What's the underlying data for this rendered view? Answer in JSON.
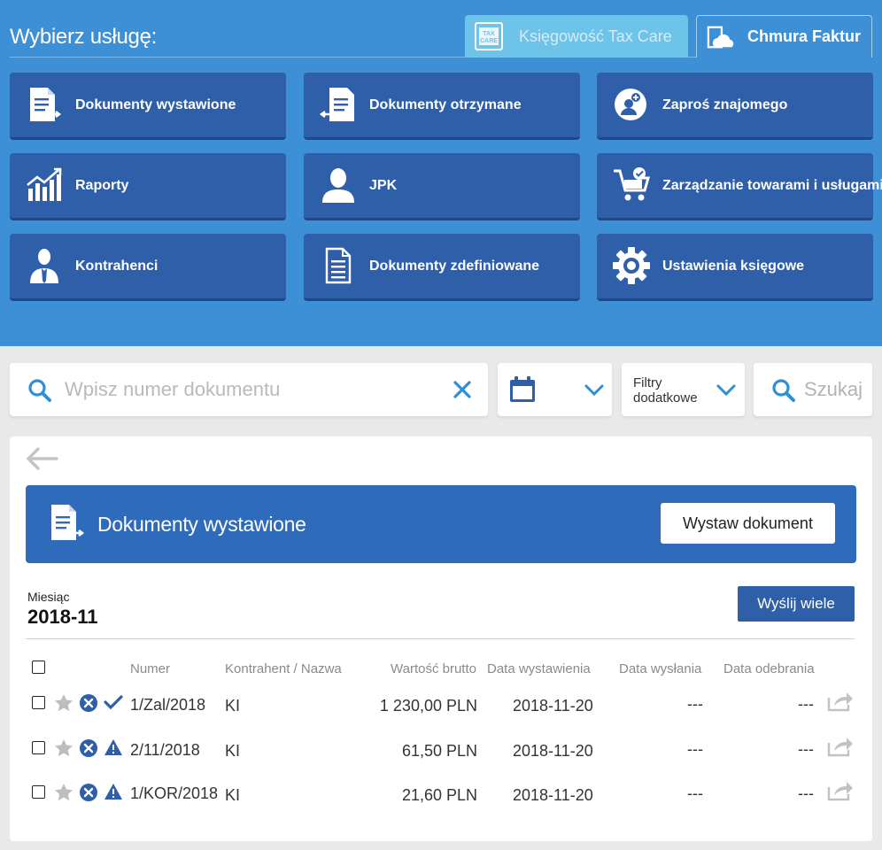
{
  "top": {
    "title": "Wybierz usługę:",
    "tabs": [
      {
        "label": "Księgowość Tax Care",
        "active": false,
        "icon": "taxcare-logo-icon"
      },
      {
        "label": "Chmura Faktur",
        "active": true,
        "icon": "cloud-document-icon"
      }
    ],
    "tiles": [
      {
        "label": "Dokumenty wystawione",
        "icon": "document-export-icon"
      },
      {
        "label": "Dokumenty otrzymane",
        "icon": "document-import-icon"
      },
      {
        "label": "Zaproś znajomego",
        "icon": "invite-user-icon"
      },
      {
        "label": "Raporty",
        "icon": "chart-trend-icon"
      },
      {
        "label": "JPK",
        "icon": "user-silhouette-icon"
      },
      {
        "label": "Zarządzanie towarami i usługami",
        "icon": "cart-check-icon"
      },
      {
        "label": "Kontrahenci",
        "icon": "businessman-icon"
      },
      {
        "label": "Dokumenty zdefiniowane",
        "icon": "document-lines-icon"
      },
      {
        "label": "Ustawienia księgowe",
        "icon": "gear-icon"
      }
    ]
  },
  "search": {
    "placeholder": "Wpisz numer dokumentu",
    "value": "",
    "filters_label_1": "Filtry",
    "filters_label_2": "dodatkowe",
    "search_button": "Szukaj"
  },
  "panel": {
    "title": "Dokumenty wystawione",
    "issue_button": "Wystaw dokument",
    "month_label": "Miesiąc",
    "month_value": "2018-11",
    "send_many_button": "Wyślij wiele",
    "columns": {
      "number": "Numer",
      "contractor": "Kontrahent / Nazwa",
      "gross": "Wartość brutto",
      "issue_date": "Data wystawienia",
      "sent_date": "Data wysłania",
      "received_date": "Data odebrania"
    },
    "rows": [
      {
        "number": "1/Zal/2018",
        "contractor": "KI",
        "gross": "1 230,00 PLN",
        "issue_date": "2018-11-20",
        "sent_date": "---",
        "received_date": "---",
        "status": "check"
      },
      {
        "number": "2/11/2018",
        "contractor": "KI",
        "gross": "61,50 PLN",
        "issue_date": "2018-11-20",
        "sent_date": "---",
        "received_date": "---",
        "status": "warning"
      },
      {
        "number": "1/KOR/2018",
        "contractor": "KI",
        "gross": "21,60 PLN",
        "issue_date": "2018-11-20",
        "sent_date": "---",
        "received_date": "---",
        "status": "warning"
      }
    ]
  },
  "colors": {
    "top_bg": "#3d8fd6",
    "tile_bg": "#2e5fa8",
    "tab_taxcare_bg": "#6ec3e8",
    "header_bar_bg": "#2e6bbb",
    "accent_icon": "#2f8fd6"
  }
}
